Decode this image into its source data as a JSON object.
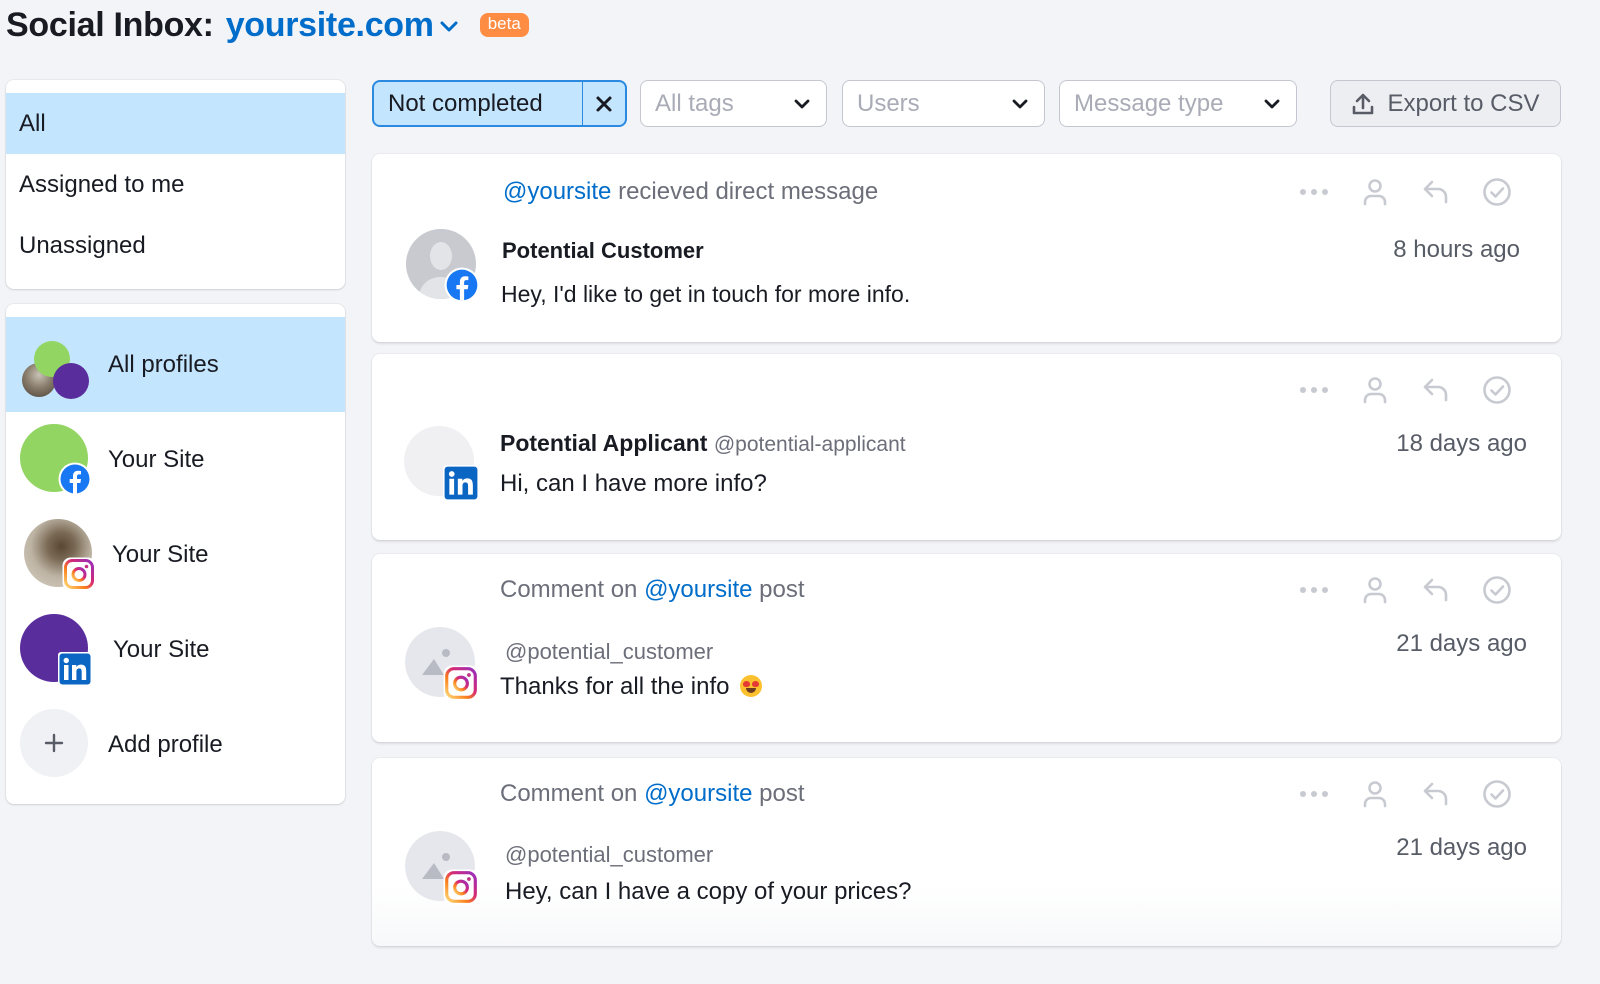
{
  "header": {
    "title": "Social Inbox:",
    "site": "yoursite.com",
    "badge": "beta"
  },
  "colors": {
    "accent": "#006dca",
    "selected_bg": "#c4e5fe",
    "beta": "#ff8c43",
    "facebook": "#1877f2",
    "linkedin": "#0a66c2",
    "profile_green": "#92d563",
    "profile_purple": "#5a2d9c"
  },
  "sidebar": {
    "filters": [
      {
        "label": "All",
        "active": true
      },
      {
        "label": "Assigned to me",
        "active": false
      },
      {
        "label": "Unassigned",
        "active": false
      }
    ],
    "profiles": [
      {
        "label": "All profiles",
        "active": true,
        "icon": "all-profiles-avatars"
      },
      {
        "label": "Your Site",
        "network": "facebook"
      },
      {
        "label": "Your Site",
        "network": "instagram"
      },
      {
        "label": "Your Site",
        "network": "linkedin"
      }
    ],
    "add_profile": {
      "label": "Add profile",
      "icon": "plus-icon"
    }
  },
  "toolbar": {
    "status_filter": "Not completed",
    "tags_placeholder": "All tags",
    "users_placeholder": "Users",
    "message_type_placeholder": "Message type",
    "export_label": "Export to CSV"
  },
  "messages": [
    {
      "context_mention": "@yoursite",
      "context_text": " recieved direct message",
      "author": "Potential Customer",
      "handle": "",
      "text": "Hey, I'd like to get in touch for more info.",
      "time": "8 hours ago",
      "network": "facebook"
    },
    {
      "context_mention": "",
      "context_text": "",
      "author": "Potential Applicant",
      "handle": "@potential-applicant",
      "text": "Hi, can I have more info?",
      "time": "18 days ago",
      "network": "linkedin"
    },
    {
      "context_prefix": "Comment on ",
      "context_mention": "@yoursite",
      "context_text": " post",
      "author": "",
      "handle": "@potential_customer",
      "text": "Thanks for all the info",
      "emoji": "heart-eyes",
      "time": "21 days ago",
      "network": "instagram"
    },
    {
      "context_prefix": "Comment on ",
      "context_mention": "@yoursite",
      "context_text": " post",
      "author": "",
      "handle": "@potential_customer",
      "text": "Hey, can I have a copy of your prices?",
      "time": "21 days ago",
      "network": "instagram"
    }
  ],
  "message_actions": [
    "more-icon",
    "assign-user-icon",
    "reply-icon",
    "complete-check-icon"
  ]
}
